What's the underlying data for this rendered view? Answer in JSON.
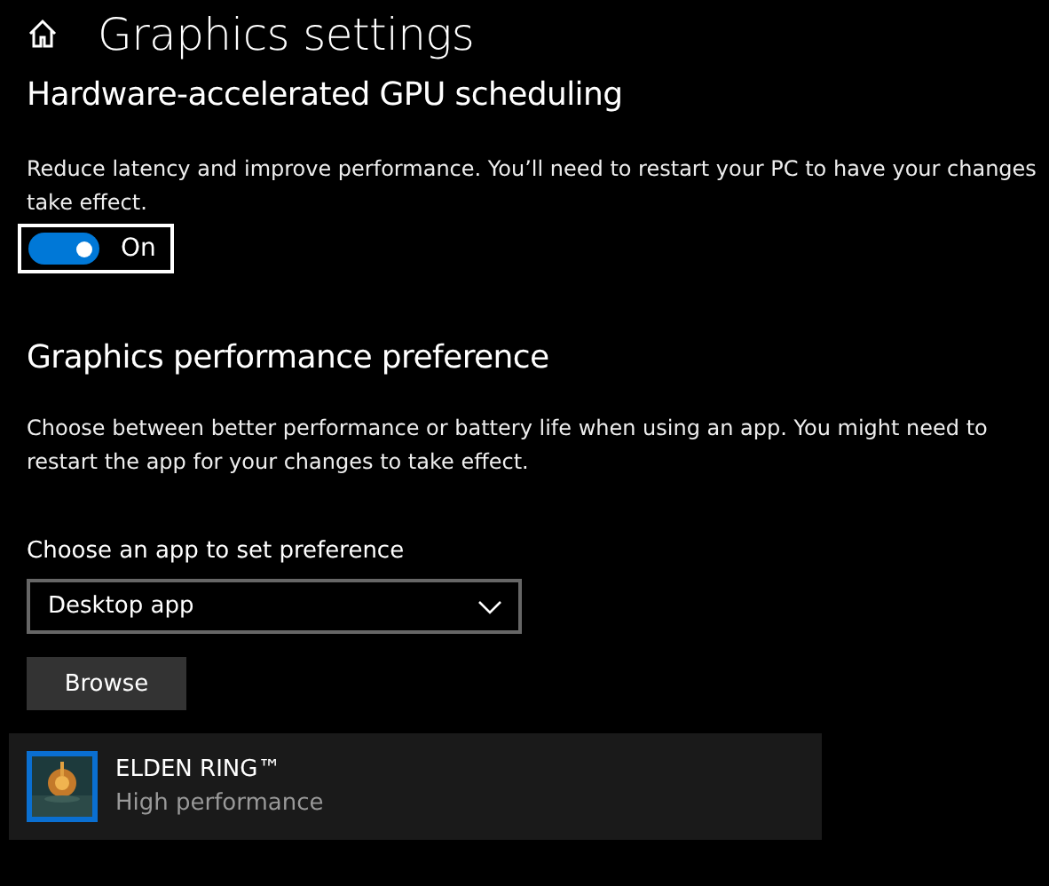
{
  "header": {
    "title": "Graphics settings"
  },
  "gpu_scheduling": {
    "heading": "Hardware-accelerated GPU scheduling",
    "description": "Reduce latency and improve performance. You’ll need to restart your PC to have your changes take effect.",
    "toggle": {
      "on": true,
      "focused": true,
      "label": "On"
    }
  },
  "performance_preference": {
    "heading": "Graphics performance preference",
    "description": "Choose between better performance or battery life when using an app. You might need to restart the app for your changes to take effect.",
    "dropdown_label": "Choose an app to set preference",
    "dropdown": {
      "value": "Desktop app"
    },
    "browse_button": "Browse",
    "apps": [
      {
        "kind": "picture",
        "name": "ELDEN RING™",
        "preference": "High performance",
        "selected": true
      }
    ]
  }
}
